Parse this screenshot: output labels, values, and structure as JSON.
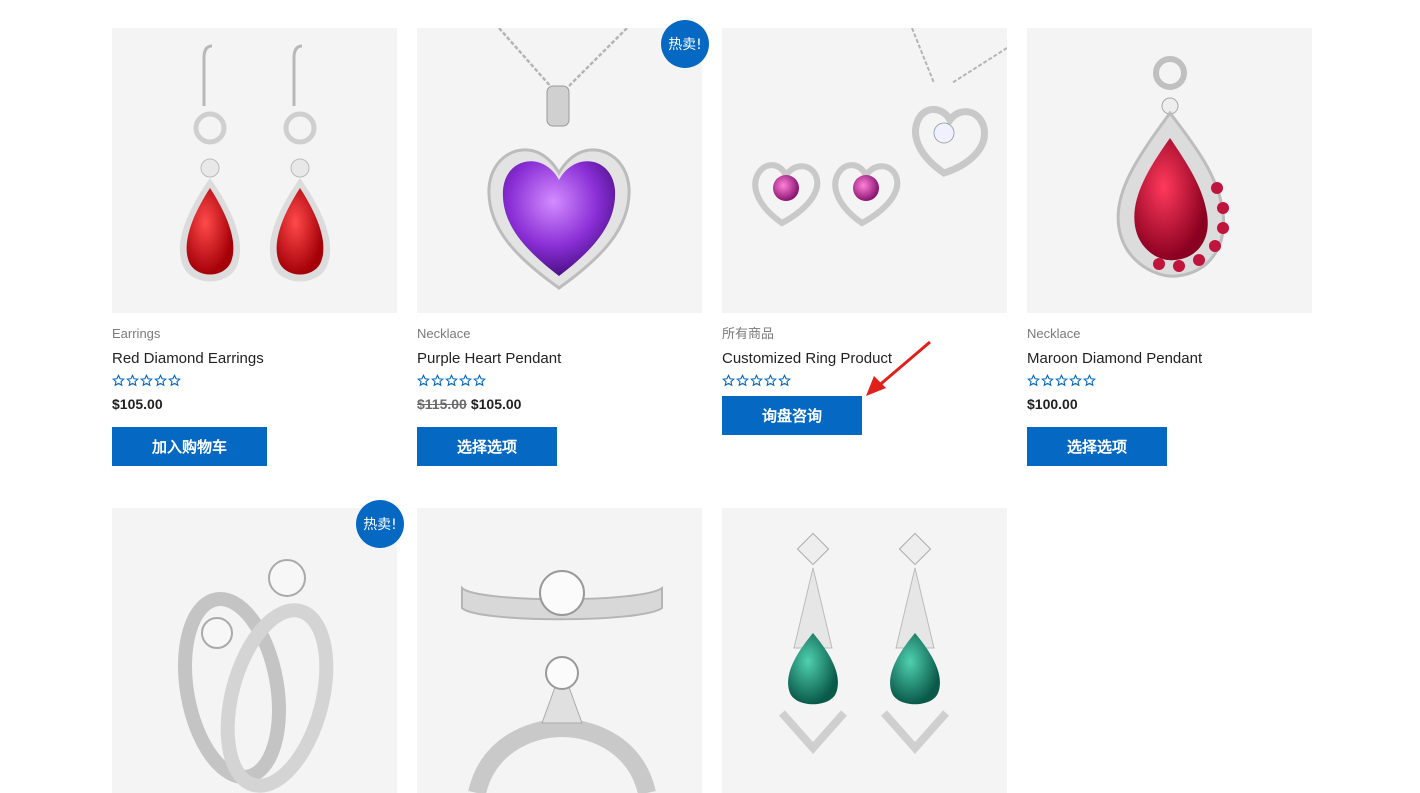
{
  "products": [
    {
      "category": "Earrings",
      "title": "Red Diamond Earrings",
      "price": "$105.00",
      "old_price": "",
      "button": "加入购物车",
      "badge": "",
      "image_icon": "red-drop-earrings"
    },
    {
      "category": "Necklace",
      "title": "Purple Heart Pendant",
      "price": "$105.00",
      "old_price": "$115.00",
      "button": "选择选项",
      "badge": "热卖!",
      "image_icon": "purple-heart-pendant"
    },
    {
      "category": "所有商品",
      "title": "Customized Ring Product",
      "price": "",
      "old_price": "",
      "button": "询盘咨询",
      "badge": "",
      "image_icon": "heart-jewelry-set"
    },
    {
      "category": "Necklace",
      "title": "Maroon Diamond Pendant",
      "price": "$100.00",
      "old_price": "",
      "button": "选择选项",
      "badge": "",
      "image_icon": "maroon-drop-pendant"
    },
    {
      "category": "",
      "title": "",
      "price": "",
      "old_price": "",
      "button": "",
      "badge": "热卖!",
      "image_icon": "diamond-ring-pair"
    },
    {
      "category": "",
      "title": "",
      "price": "",
      "old_price": "",
      "button": "",
      "badge": "",
      "image_icon": "solitaire-ring"
    },
    {
      "category": "",
      "title": "",
      "price": "",
      "old_price": "",
      "button": "",
      "badge": "",
      "image_icon": "emerald-drop-earrings"
    }
  ],
  "rating": {
    "stars": 5,
    "filled": 0
  },
  "colors": {
    "accent": "#0568c2",
    "annotation_arrow": "#e0201c"
  }
}
